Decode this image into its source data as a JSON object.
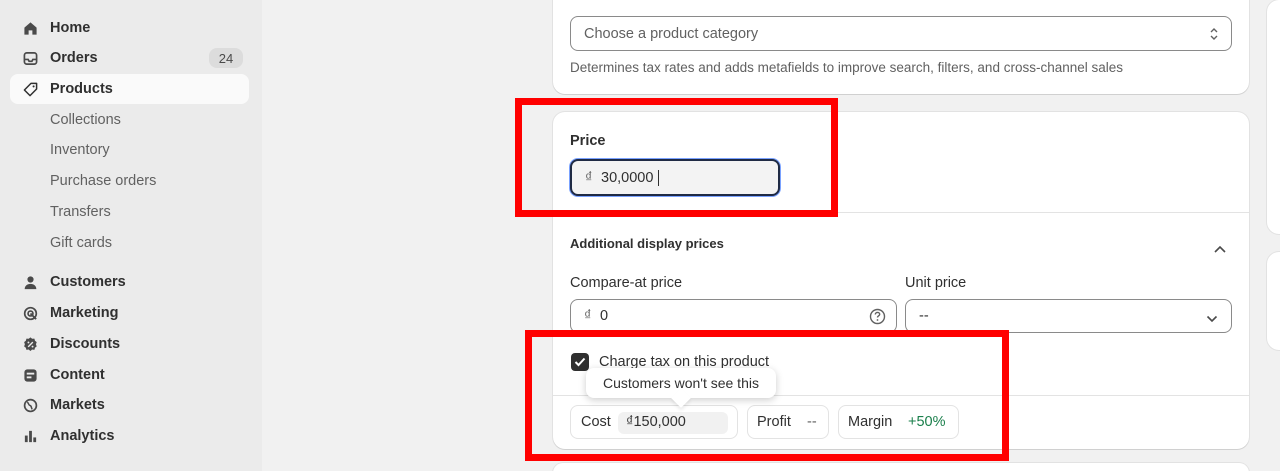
{
  "sidebar": {
    "items": [
      {
        "label": "Home",
        "icon": "home-icon"
      },
      {
        "label": "Orders",
        "icon": "orders-icon",
        "badge": "24"
      },
      {
        "label": "Products",
        "icon": "tag-icon"
      },
      {
        "label": "Collections"
      },
      {
        "label": "Inventory"
      },
      {
        "label": "Purchase orders"
      },
      {
        "label": "Transfers"
      },
      {
        "label": "Gift cards"
      },
      {
        "label": "Customers",
        "icon": "person-icon"
      },
      {
        "label": "Marketing",
        "icon": "target-icon"
      },
      {
        "label": "Discounts",
        "icon": "discount-icon"
      },
      {
        "label": "Content",
        "icon": "content-icon"
      },
      {
        "label": "Markets",
        "icon": "globe-icon"
      },
      {
        "label": "Analytics",
        "icon": "bar-chart-icon"
      }
    ]
  },
  "category": {
    "placeholder": "Choose a product category",
    "help": "Determines tax rates and adds metafields to improve search, filters, and cross-channel sales"
  },
  "pricing": {
    "price_label": "Price",
    "currency": "₫",
    "price_value": "30,0000",
    "additional_title": "Additional display prices",
    "compare_label": "Compare-at price",
    "compare_value": "0",
    "unit_label": "Unit price",
    "unit_value": "--",
    "tax_label": "Charge tax on this product",
    "tax_checked": true,
    "tooltip": "Customers won't see this",
    "cost_label": "Cost",
    "cost_value": "₫150,000",
    "profit_label": "Profit",
    "profit_value": "--",
    "margin_label": "Margin",
    "margin_value": "+50%"
  },
  "colors": {
    "highlight": "#ff0000",
    "margin_green": "#1a7f4b",
    "focus_border": "#1f2a44"
  }
}
